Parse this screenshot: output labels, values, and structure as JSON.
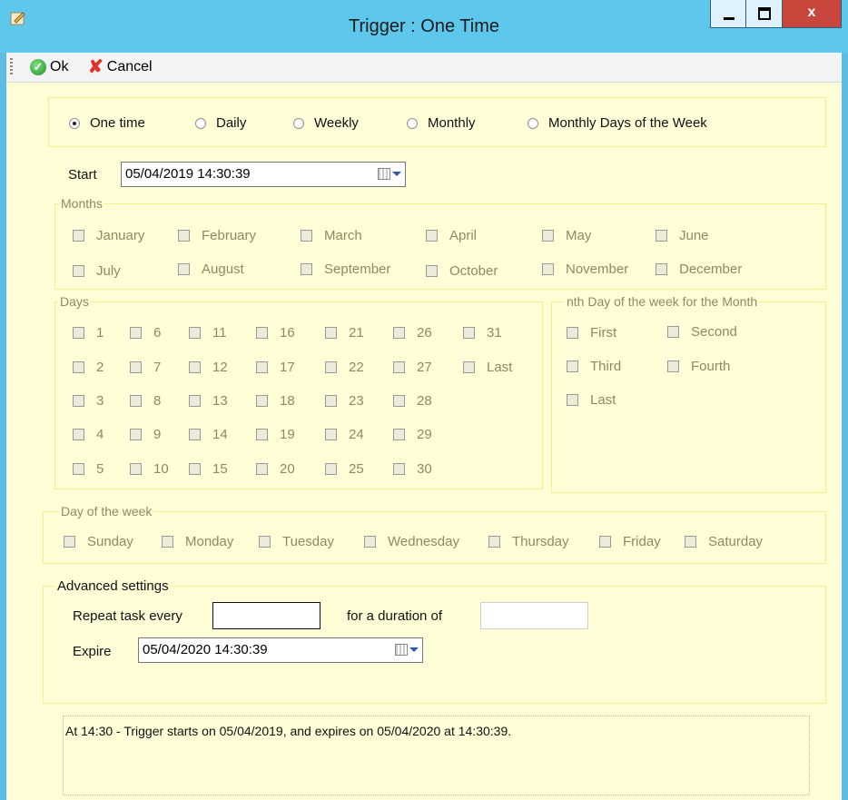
{
  "window": {
    "title": "Trigger : One Time",
    "minimize_label": "minimize",
    "maximize_label": "maximize",
    "close_label": "x"
  },
  "toolbar": {
    "ok_label": "Ok",
    "cancel_label": "Cancel"
  },
  "schedule": {
    "options": [
      "One time",
      "Daily",
      "Weekly",
      "Monthly",
      "Monthly Days of the Week"
    ],
    "selected": "One time"
  },
  "start": {
    "label": "Start",
    "value": "05/04/2019 14:30:39"
  },
  "months": {
    "title": "Months",
    "items": [
      "January",
      "February",
      "March",
      "April",
      "May",
      "June",
      "July",
      "August",
      "September",
      "October",
      "November",
      "December"
    ]
  },
  "days": {
    "title": "Days",
    "items": [
      "1",
      "2",
      "3",
      "4",
      "5",
      "6",
      "7",
      "8",
      "9",
      "10",
      "11",
      "12",
      "13",
      "14",
      "15",
      "16",
      "17",
      "18",
      "19",
      "20",
      "21",
      "22",
      "23",
      "24",
      "25",
      "26",
      "27",
      "28",
      "29",
      "30",
      "31",
      "Last"
    ]
  },
  "nth_day": {
    "title": "nth Day of the week for the Month",
    "items": [
      "First",
      "Second",
      "Third",
      "Fourth",
      "Last"
    ]
  },
  "day_of_week": {
    "title": "Day of the week",
    "items": [
      "Sunday",
      "Monday",
      "Tuesday",
      "Wednesday",
      "Thursday",
      "Friday",
      "Saturday"
    ]
  },
  "advanced": {
    "title": "Advanced settings",
    "repeat_label": "Repeat task every",
    "repeat_value": "",
    "duration_label": "for a duration of",
    "duration_value": "",
    "expire_label": "Expire",
    "expire_value": "05/04/2020 14:30:39"
  },
  "summary": "At 14:30  - Trigger starts on 05/04/2019, and expires on 05/04/2020 at 14:30:39.",
  "colors": {
    "titlebar": "#5ec8ec",
    "background": "#fffed6",
    "frame_border": "#f2f086",
    "close_button": "#c9463d",
    "disabled_text": "#8c8a60"
  }
}
